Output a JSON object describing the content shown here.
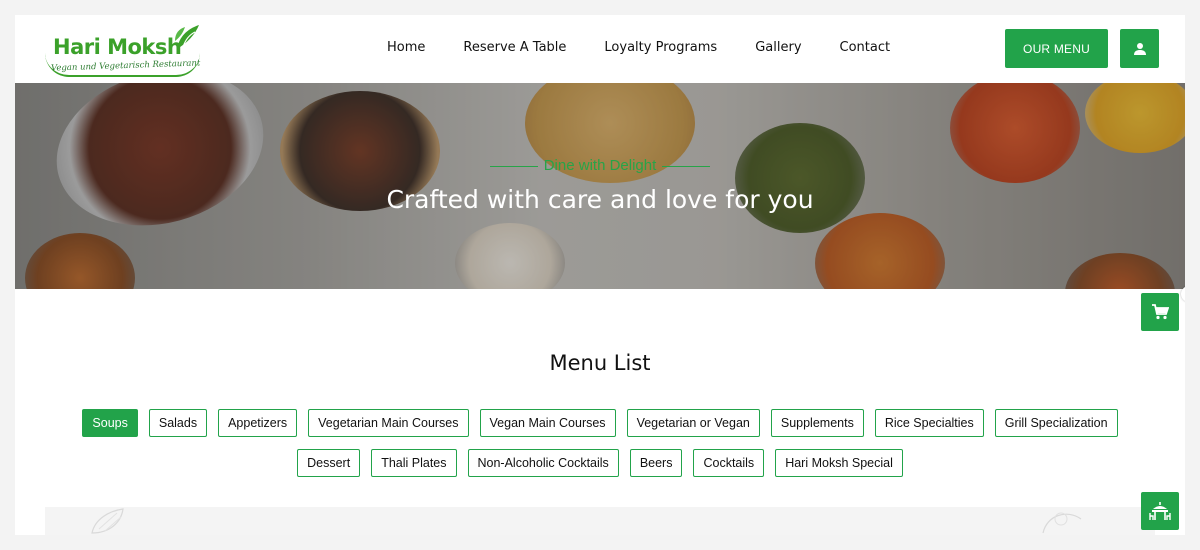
{
  "brand": {
    "name": "Hari Moksh",
    "tagline": "Vegan und Vegetarisch Restaurant"
  },
  "nav": {
    "items": [
      "Home",
      "Reserve A Table",
      "Loyalty Programs",
      "Gallery",
      "Contact"
    ]
  },
  "header": {
    "our_menu_label": "OUR MENU",
    "user_icon": "user-icon"
  },
  "hero": {
    "tag": "Dine with Delight",
    "title": "Crafted with care and love for you"
  },
  "cart": {
    "count": "0",
    "icon": "cart-icon"
  },
  "menu": {
    "title": "Menu List",
    "categories": [
      "Soups",
      "Salads",
      "Appetizers",
      "Vegetarian Main Courses",
      "Vegan Main Courses",
      "Vegetarian or Vegan",
      "Supplements",
      "Rice Specialties",
      "Grill Specialization",
      "Dessert",
      "Thali Plates",
      "Non-Alcoholic Cocktails",
      "Beers",
      "Cocktails",
      "Hari Moksh Special"
    ],
    "active": "Soups"
  },
  "colors": {
    "accent": "#22a34a",
    "logo_green": "#3ba12a"
  }
}
